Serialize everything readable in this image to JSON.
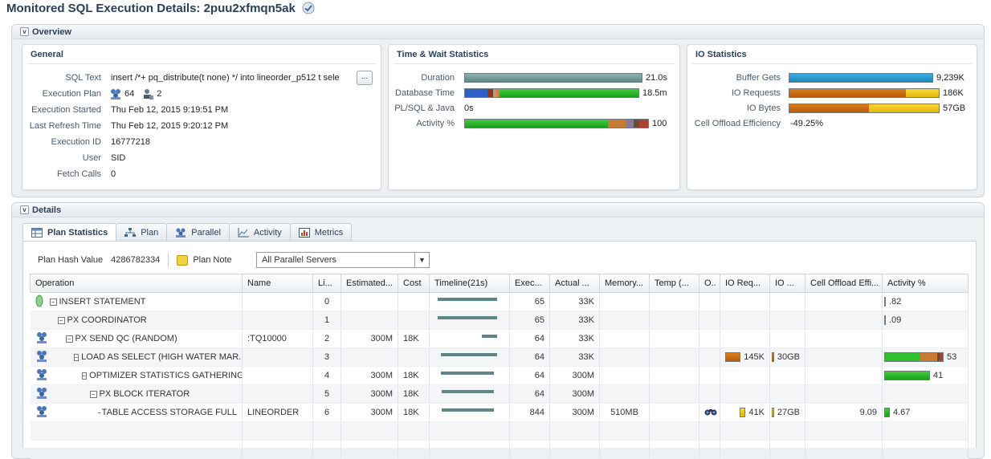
{
  "page": {
    "title": "Monitored SQL Execution Details: 2puu2xfmqn5ak"
  },
  "overview": {
    "header": "Overview",
    "general": {
      "title": "General",
      "sql_text_label": "SQL Text",
      "sql_text_value": "insert /*+ pq_distribute(t none) */ into lineorder_p512 t sele",
      "sql_text_button": "...",
      "execution_plan_label": "Execution Plan",
      "execution_plan_servers": "64",
      "execution_plan_instances": "2",
      "execution_started_label": "Execution Started",
      "execution_started_value": "Thu Feb 12, 2015 9:19:51 PM",
      "last_refresh_label": "Last Refresh Time",
      "last_refresh_value": "Thu Feb 12, 2015 9:20:12 PM",
      "execution_id_label": "Execution ID",
      "execution_id_value": "16777218",
      "user_label": "User",
      "user_value": "SID",
      "fetch_calls_label": "Fetch Calls",
      "fetch_calls_value": "0"
    },
    "time_wait": {
      "title": "Time & Wait Statistics",
      "duration_label": "Duration",
      "duration_value": "21.0s",
      "database_time_label": "Database Time",
      "database_time_value": "18.5m",
      "plsql_java_label": "PL/SQL & Java",
      "plsql_java_value": "0s",
      "activity_label": "Activity %",
      "activity_value": "100"
    },
    "io": {
      "title": "IO Statistics",
      "buffer_gets_label": "Buffer Gets",
      "buffer_gets_value": "9,239K",
      "io_requests_label": "IO Requests",
      "io_requests_value": "186K",
      "io_bytes_label": "IO Bytes",
      "io_bytes_value": "57GB",
      "cell_offload_label": "Cell Offload Efficiency",
      "cell_offload_value": "-49.25%"
    }
  },
  "details": {
    "header": "Details",
    "tabs": [
      {
        "label": "Plan Statistics",
        "icon": "table-icon"
      },
      {
        "label": "Plan",
        "icon": "plan-tree-icon"
      },
      {
        "label": "Parallel",
        "icon": "parallel-servers-icon"
      },
      {
        "label": "Activity",
        "icon": "activity-chart-icon"
      },
      {
        "label": "Metrics",
        "icon": "metrics-icon"
      }
    ],
    "plan_hash_label": "Plan Hash Value",
    "plan_hash_value": "4286782334",
    "plan_note_label": "Plan Note",
    "server_filter": "All Parallel Servers",
    "columns": [
      "Operation",
      "Name",
      "Li...",
      "Estimated...",
      "Cost",
      "Timeline(21s)",
      "Exec...",
      "Actual ...",
      "Memory...",
      "Temp (...",
      "O..",
      "IO Req...",
      "IO ...",
      "Cell Offload Effi...",
      "Activity %"
    ],
    "rows": [
      {
        "operation": "INSERT STATEMENT",
        "name": "",
        "line": "0",
        "estimated": "",
        "cost": "",
        "timeline": [
          0.05,
          0.95
        ],
        "exec": "65",
        "actual": "33K",
        "memory": "",
        "temp": "",
        "io_req": "",
        "io_bytes": "",
        "cell_offload": "",
        "activity": ".82",
        "activity_pct": 0.82
      },
      {
        "operation": "PX COORDINATOR",
        "name": "",
        "line": "1",
        "estimated": "",
        "cost": "",
        "timeline": [
          0.05,
          0.95
        ],
        "exec": "65",
        "actual": "33K",
        "memory": "",
        "temp": "",
        "io_req": "",
        "io_bytes": "",
        "cell_offload": "",
        "activity": ".09",
        "activity_pct": 0.09
      },
      {
        "operation": "PX SEND QC (RANDOM)",
        "name": ":TQ10000",
        "line": "2",
        "estimated": "300M",
        "cost": "18K",
        "timeline": [
          0.75,
          0.25
        ],
        "exec": "64",
        "actual": "33K",
        "memory": "",
        "temp": "",
        "io_req": "",
        "io_bytes": "",
        "cell_offload": "",
        "activity": "",
        "activity_pct": 0
      },
      {
        "operation": "LOAD AS SELECT (HIGH WATER MAR...",
        "name": "",
        "line": "3",
        "estimated": "",
        "cost": "",
        "timeline": [
          0.1,
          0.9
        ],
        "exec": "64",
        "actual": "33K",
        "memory": "",
        "temp": "",
        "io_req": "145K",
        "io_bytes": "30GB",
        "cell_offload": "",
        "activity": "53",
        "activity_pct": 53
      },
      {
        "operation": "OPTIMIZER STATISTICS GATHERING",
        "name": "",
        "line": "4",
        "estimated": "300M",
        "cost": "18K",
        "timeline": [
          0.1,
          0.85
        ],
        "exec": "64",
        "actual": "300M",
        "memory": "",
        "temp": "",
        "io_req": "",
        "io_bytes": "",
        "cell_offload": "",
        "activity": "41",
        "activity_pct": 41
      },
      {
        "operation": "PX BLOCK ITERATOR",
        "name": "",
        "line": "5",
        "estimated": "300M",
        "cost": "18K",
        "timeline": [
          0.12,
          0.83
        ],
        "exec": "64",
        "actual": "300M",
        "memory": "",
        "temp": "",
        "io_req": "",
        "io_bytes": "",
        "cell_offload": "",
        "activity": "",
        "activity_pct": 0
      },
      {
        "operation": "TABLE ACCESS STORAGE FULL",
        "name": "LINEORDER",
        "line": "6",
        "estimated": "300M",
        "cost": "18K",
        "timeline": [
          0.12,
          0.83
        ],
        "exec": "844",
        "actual": "300M",
        "memory": "510MB",
        "temp": "",
        "io_req": "41K",
        "io_bytes": "27GB",
        "cell_offload": "9.09",
        "activity": "4.67",
        "activity_pct": 4.67
      }
    ]
  }
}
